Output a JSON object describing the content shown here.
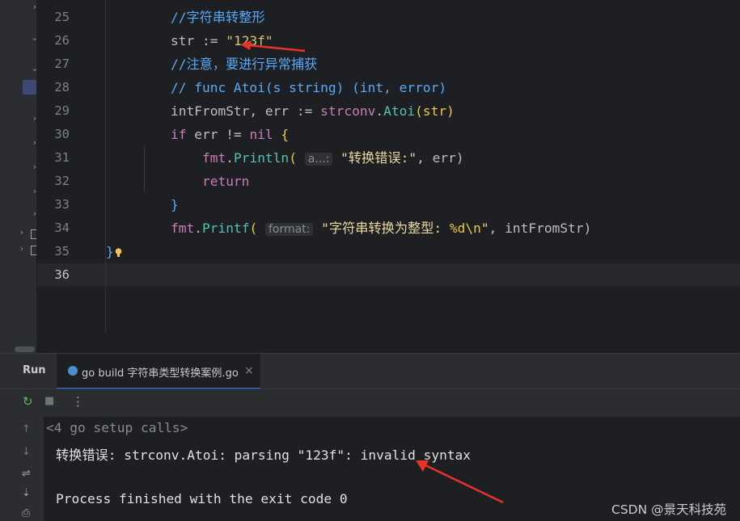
{
  "editor": {
    "lines": [
      {
        "num": "25",
        "comment": "//字符串转整形"
      },
      {
        "num": "26",
        "var": "str",
        "op": " := ",
        "string": "\"123f\""
      },
      {
        "num": "27",
        "comment": "//注意，要进行异常捕获"
      },
      {
        "num": "28",
        "comment": "// func Atoi(s string) (int, error)"
      },
      {
        "num": "29",
        "lhs": "intFromStr, err := ",
        "pkg": "strconv",
        "dot": ".",
        "fn": "Atoi",
        "args": "(str)"
      },
      {
        "num": "30",
        "kw": "if",
        "mid": " err != ",
        "nil": "nil",
        "brace": " {"
      },
      {
        "num": "31",
        "pkg": "fmt",
        "dot": ".",
        "fn": "Println",
        "open": "(",
        "hint": "a...:",
        "string": "\"转换错误:\"",
        "tail": ", err)"
      },
      {
        "num": "32",
        "kw": "return"
      },
      {
        "num": "33",
        "brace": "}"
      },
      {
        "num": "34",
        "pkg": "fmt",
        "dot": ".",
        "fn": "Printf",
        "open": "(",
        "hint": "format:",
        "string_a": "\"字符串转换为整型: ",
        "esc": "%d\\n",
        "string_b": "\"",
        "tail": ", intFromStr)"
      },
      {
        "num": "35",
        "brace": "}"
      },
      {
        "num": "36"
      }
    ],
    "bulb_icon": "lightbulb-icon",
    "accent_color": "#3574f0"
  },
  "run": {
    "title": "Run",
    "tab_label": "go build 字符串类型转换案例.go",
    "tab_close": "×",
    "toolbar": {
      "rerun_icon": "↻",
      "stop_icon": "■",
      "more_icon": "⋮"
    },
    "side_icons": {
      "up": "↑",
      "down": "↓",
      "wrap": "⇌",
      "scroll": "⇣",
      "print": "⎙"
    },
    "output": {
      "calls": "<4 go setup calls>",
      "error_line": "转换错误: strconv.Atoi: parsing \"123f\": invalid syntax",
      "exit_line": "Process finished with the exit code 0"
    }
  },
  "watermark": "CSDN @景天科技苑"
}
